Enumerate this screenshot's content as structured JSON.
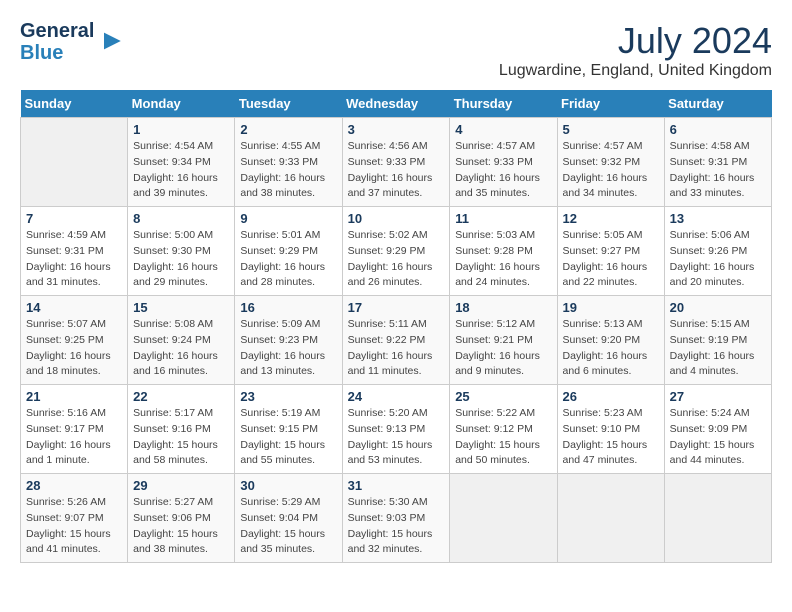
{
  "header": {
    "logo_line1": "General",
    "logo_line2": "Blue",
    "month_year": "July 2024",
    "location": "Lugwardine, England, United Kingdom"
  },
  "weekdays": [
    "Sunday",
    "Monday",
    "Tuesday",
    "Wednesday",
    "Thursday",
    "Friday",
    "Saturday"
  ],
  "weeks": [
    [
      {
        "day": "",
        "info": ""
      },
      {
        "day": "1",
        "info": "Sunrise: 4:54 AM\nSunset: 9:34 PM\nDaylight: 16 hours\nand 39 minutes."
      },
      {
        "day": "2",
        "info": "Sunrise: 4:55 AM\nSunset: 9:33 PM\nDaylight: 16 hours\nand 38 minutes."
      },
      {
        "day": "3",
        "info": "Sunrise: 4:56 AM\nSunset: 9:33 PM\nDaylight: 16 hours\nand 37 minutes."
      },
      {
        "day": "4",
        "info": "Sunrise: 4:57 AM\nSunset: 9:33 PM\nDaylight: 16 hours\nand 35 minutes."
      },
      {
        "day": "5",
        "info": "Sunrise: 4:57 AM\nSunset: 9:32 PM\nDaylight: 16 hours\nand 34 minutes."
      },
      {
        "day": "6",
        "info": "Sunrise: 4:58 AM\nSunset: 9:31 PM\nDaylight: 16 hours\nand 33 minutes."
      }
    ],
    [
      {
        "day": "7",
        "info": "Sunrise: 4:59 AM\nSunset: 9:31 PM\nDaylight: 16 hours\nand 31 minutes."
      },
      {
        "day": "8",
        "info": "Sunrise: 5:00 AM\nSunset: 9:30 PM\nDaylight: 16 hours\nand 29 minutes."
      },
      {
        "day": "9",
        "info": "Sunrise: 5:01 AM\nSunset: 9:29 PM\nDaylight: 16 hours\nand 28 minutes."
      },
      {
        "day": "10",
        "info": "Sunrise: 5:02 AM\nSunset: 9:29 PM\nDaylight: 16 hours\nand 26 minutes."
      },
      {
        "day": "11",
        "info": "Sunrise: 5:03 AM\nSunset: 9:28 PM\nDaylight: 16 hours\nand 24 minutes."
      },
      {
        "day": "12",
        "info": "Sunrise: 5:05 AM\nSunset: 9:27 PM\nDaylight: 16 hours\nand 22 minutes."
      },
      {
        "day": "13",
        "info": "Sunrise: 5:06 AM\nSunset: 9:26 PM\nDaylight: 16 hours\nand 20 minutes."
      }
    ],
    [
      {
        "day": "14",
        "info": "Sunrise: 5:07 AM\nSunset: 9:25 PM\nDaylight: 16 hours\nand 18 minutes."
      },
      {
        "day": "15",
        "info": "Sunrise: 5:08 AM\nSunset: 9:24 PM\nDaylight: 16 hours\nand 16 minutes."
      },
      {
        "day": "16",
        "info": "Sunrise: 5:09 AM\nSunset: 9:23 PM\nDaylight: 16 hours\nand 13 minutes."
      },
      {
        "day": "17",
        "info": "Sunrise: 5:11 AM\nSunset: 9:22 PM\nDaylight: 16 hours\nand 11 minutes."
      },
      {
        "day": "18",
        "info": "Sunrise: 5:12 AM\nSunset: 9:21 PM\nDaylight: 16 hours\nand 9 minutes."
      },
      {
        "day": "19",
        "info": "Sunrise: 5:13 AM\nSunset: 9:20 PM\nDaylight: 16 hours\nand 6 minutes."
      },
      {
        "day": "20",
        "info": "Sunrise: 5:15 AM\nSunset: 9:19 PM\nDaylight: 16 hours\nand 4 minutes."
      }
    ],
    [
      {
        "day": "21",
        "info": "Sunrise: 5:16 AM\nSunset: 9:17 PM\nDaylight: 16 hours\nand 1 minute."
      },
      {
        "day": "22",
        "info": "Sunrise: 5:17 AM\nSunset: 9:16 PM\nDaylight: 15 hours\nand 58 minutes."
      },
      {
        "day": "23",
        "info": "Sunrise: 5:19 AM\nSunset: 9:15 PM\nDaylight: 15 hours\nand 55 minutes."
      },
      {
        "day": "24",
        "info": "Sunrise: 5:20 AM\nSunset: 9:13 PM\nDaylight: 15 hours\nand 53 minutes."
      },
      {
        "day": "25",
        "info": "Sunrise: 5:22 AM\nSunset: 9:12 PM\nDaylight: 15 hours\nand 50 minutes."
      },
      {
        "day": "26",
        "info": "Sunrise: 5:23 AM\nSunset: 9:10 PM\nDaylight: 15 hours\nand 47 minutes."
      },
      {
        "day": "27",
        "info": "Sunrise: 5:24 AM\nSunset: 9:09 PM\nDaylight: 15 hours\nand 44 minutes."
      }
    ],
    [
      {
        "day": "28",
        "info": "Sunrise: 5:26 AM\nSunset: 9:07 PM\nDaylight: 15 hours\nand 41 minutes."
      },
      {
        "day": "29",
        "info": "Sunrise: 5:27 AM\nSunset: 9:06 PM\nDaylight: 15 hours\nand 38 minutes."
      },
      {
        "day": "30",
        "info": "Sunrise: 5:29 AM\nSunset: 9:04 PM\nDaylight: 15 hours\nand 35 minutes."
      },
      {
        "day": "31",
        "info": "Sunrise: 5:30 AM\nSunset: 9:03 PM\nDaylight: 15 hours\nand 32 minutes."
      },
      {
        "day": "",
        "info": ""
      },
      {
        "day": "",
        "info": ""
      },
      {
        "day": "",
        "info": ""
      }
    ]
  ]
}
